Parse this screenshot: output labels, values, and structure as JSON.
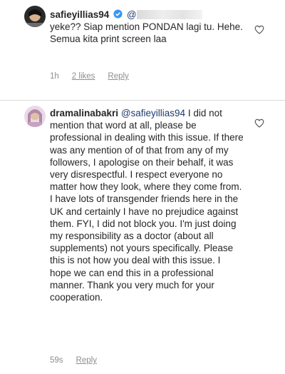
{
  "comments": [
    {
      "username": "safieyillias94",
      "mention": "@",
      "text": "yeke?? Siap mention PONDAN lagi tu. Hehe. Semua kita print screen laa",
      "time": "1h",
      "likes": "2 likes",
      "reply": "Reply",
      "icons": {
        "verified": "verified-badge-icon",
        "like": "heart-icon"
      }
    },
    {
      "username": "dramalinabakri",
      "mention": "@safieyillias94",
      "text": "I did not mention that word at all, please be professional in dealing with this issue. If there was any mention of of that from any of my followers, I apologise on their behalf, it was very disrespectful. I respect everyone no matter how they look, where they come from. I have lots of transgender friends here in the UK and certainly I have no prejudice against them. FYI, I did not block you. I'm just doing my responsibility as a doctor (about all supplements) not yours specifically. Please this is not how you deal with this issue. I hope we can end this in a professional manner. Thank you very much for your cooperation.",
      "time": "59s",
      "reply": "Reply",
      "icons": {
        "like": "heart-icon"
      }
    }
  ],
  "colors": {
    "verified": "#3897f0",
    "mention": "#1f3b6f",
    "meta": "#8e8e8e"
  }
}
